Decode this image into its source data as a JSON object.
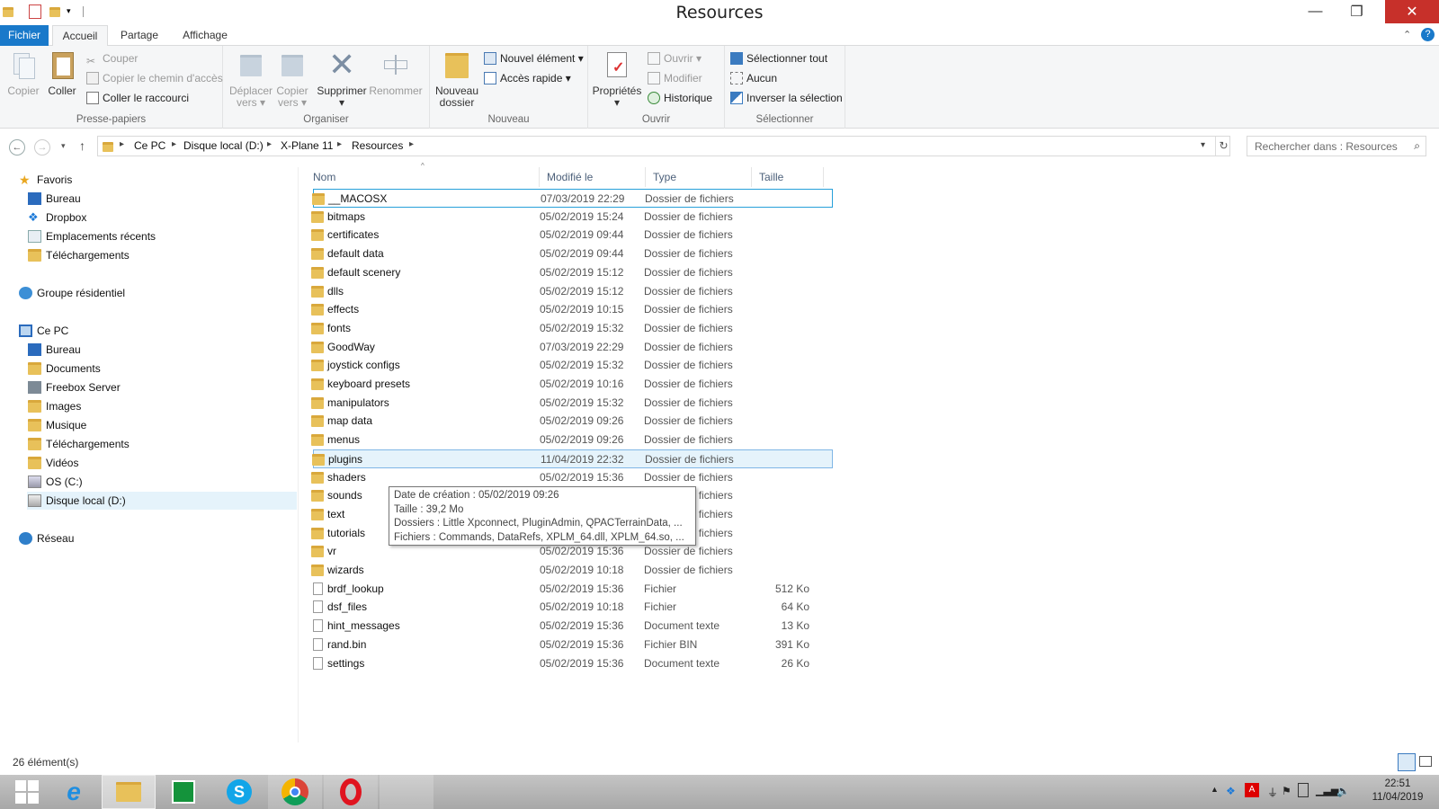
{
  "window": {
    "title": "Resources"
  },
  "ribbon_tabs": [
    "Fichier",
    "Accueil",
    "Partage",
    "Affichage"
  ],
  "ribbon": {
    "clipboard": {
      "copy": "Copier",
      "paste": "Coller",
      "cut": "Couper",
      "copy_path": "Copier le chemin d'accès",
      "paste_shortcut": "Coller le raccourci",
      "label": "Presse-papiers"
    },
    "organize": {
      "move_line1": "Déplacer",
      "move_line2": "vers",
      "copyto_line1": "Copier",
      "copyto_line2": "vers",
      "delete": "Supprimer",
      "rename": "Renommer",
      "label": "Organiser"
    },
    "new": {
      "new_folder_line1": "Nouveau",
      "new_folder_line2": "dossier",
      "new_item": "Nouvel élément",
      "easy_access": "Accès rapide",
      "label": "Nouveau"
    },
    "open": {
      "properties": "Propriétés",
      "open": "Ouvrir",
      "edit": "Modifier",
      "history": "Historique",
      "label": "Ouvrir"
    },
    "select": {
      "select_all": "Sélectionner tout",
      "select_none": "Aucun",
      "invert": "Inverser la sélection",
      "label": "Sélectionner"
    }
  },
  "address": {
    "crumbs": [
      "Ce PC",
      "Disque local (D:)",
      "X-Plane 11",
      "Resources"
    ],
    "search_placeholder": "Rechercher dans : Resources"
  },
  "nav": {
    "favorites": "Favoris",
    "fav_items": [
      "Bureau",
      "Dropbox",
      "Emplacements récents",
      "Téléchargements"
    ],
    "homegroup": "Groupe résidentiel",
    "thispc": "Ce PC",
    "pc_items": [
      "Bureau",
      "Documents",
      "Freebox Server",
      "Images",
      "Musique",
      "Téléchargements",
      "Vidéos",
      "OS (C:)",
      "Disque local (D:)"
    ],
    "network": "Réseau"
  },
  "columns": {
    "name": "Nom",
    "modified": "Modifié le",
    "type": "Type",
    "size": "Taille"
  },
  "files": [
    {
      "name": "__MACOSX",
      "date": "07/03/2019 22:29",
      "type": "Dossier de fichiers",
      "size": ""
    },
    {
      "name": "bitmaps",
      "date": "05/02/2019 15:24",
      "type": "Dossier de fichiers",
      "size": ""
    },
    {
      "name": "certificates",
      "date": "05/02/2019 09:44",
      "type": "Dossier de fichiers",
      "size": ""
    },
    {
      "name": "default data",
      "date": "05/02/2019 09:44",
      "type": "Dossier de fichiers",
      "size": ""
    },
    {
      "name": "default scenery",
      "date": "05/02/2019 15:12",
      "type": "Dossier de fichiers",
      "size": ""
    },
    {
      "name": "dlls",
      "date": "05/02/2019 15:12",
      "type": "Dossier de fichiers",
      "size": ""
    },
    {
      "name": "effects",
      "date": "05/02/2019 10:15",
      "type": "Dossier de fichiers",
      "size": ""
    },
    {
      "name": "fonts",
      "date": "05/02/2019 15:32",
      "type": "Dossier de fichiers",
      "size": ""
    },
    {
      "name": "GoodWay",
      "date": "07/03/2019 22:29",
      "type": "Dossier de fichiers",
      "size": ""
    },
    {
      "name": "joystick configs",
      "date": "05/02/2019 15:32",
      "type": "Dossier de fichiers",
      "size": ""
    },
    {
      "name": "keyboard presets",
      "date": "05/02/2019 10:16",
      "type": "Dossier de fichiers",
      "size": ""
    },
    {
      "name": "manipulators",
      "date": "05/02/2019 15:32",
      "type": "Dossier de fichiers",
      "size": ""
    },
    {
      "name": "map data",
      "date": "05/02/2019 09:26",
      "type": "Dossier de fichiers",
      "size": ""
    },
    {
      "name": "menus",
      "date": "05/02/2019 09:26",
      "type": "Dossier de fichiers",
      "size": ""
    },
    {
      "name": "plugins",
      "date": "11/04/2019 22:32",
      "type": "Dossier de fichiers",
      "size": ""
    },
    {
      "name": "shaders",
      "date": "05/02/2019 15:36",
      "type": "Dossier de fichiers",
      "size": ""
    },
    {
      "name": "sounds",
      "date": "",
      "type": "Dossier de fichiers",
      "size": ""
    },
    {
      "name": "text",
      "date": "",
      "type": "Dossier de fichiers",
      "size": ""
    },
    {
      "name": "tutorials",
      "date": "05/02/2019 09:26",
      "type": "Dossier de fichiers",
      "size": ""
    },
    {
      "name": "vr",
      "date": "05/02/2019 15:36",
      "type": "Dossier de fichiers",
      "size": ""
    },
    {
      "name": "wizards",
      "date": "05/02/2019 10:18",
      "type": "Dossier de fichiers",
      "size": ""
    },
    {
      "name": "brdf_lookup",
      "date": "05/02/2019 15:36",
      "type": "Fichier",
      "size": "512 Ko"
    },
    {
      "name": "dsf_files",
      "date": "05/02/2019 10:18",
      "type": "Fichier",
      "size": "64 Ko"
    },
    {
      "name": "hint_messages",
      "date": "05/02/2019 15:36",
      "type": "Document texte",
      "size": "13 Ko"
    },
    {
      "name": "rand.bin",
      "date": "05/02/2019 15:36",
      "type": "Fichier BIN",
      "size": "391 Ko"
    },
    {
      "name": "settings",
      "date": "05/02/2019 15:36",
      "type": "Document texte",
      "size": "26 Ko"
    }
  ],
  "tooltip": {
    "line1": "Date de création : 05/02/2019 09:26",
    "line2": "Taille : 39,2 Mo",
    "line3": "Dossiers : Little Xpconnect, PluginAdmin, QPACTerrainData, ...",
    "line4": "Fichiers : Commands, DataRefs, XPLM_64.dll, XPLM_64.so, ..."
  },
  "status": {
    "count": "26 élément(s)"
  },
  "taskbar": {
    "time": "22:51",
    "date": "11/04/2019"
  },
  "colors": {
    "accent": "#1979ca",
    "close": "#c7302a",
    "folder": "#e8c15a",
    "selection": "#e5f3fb"
  }
}
